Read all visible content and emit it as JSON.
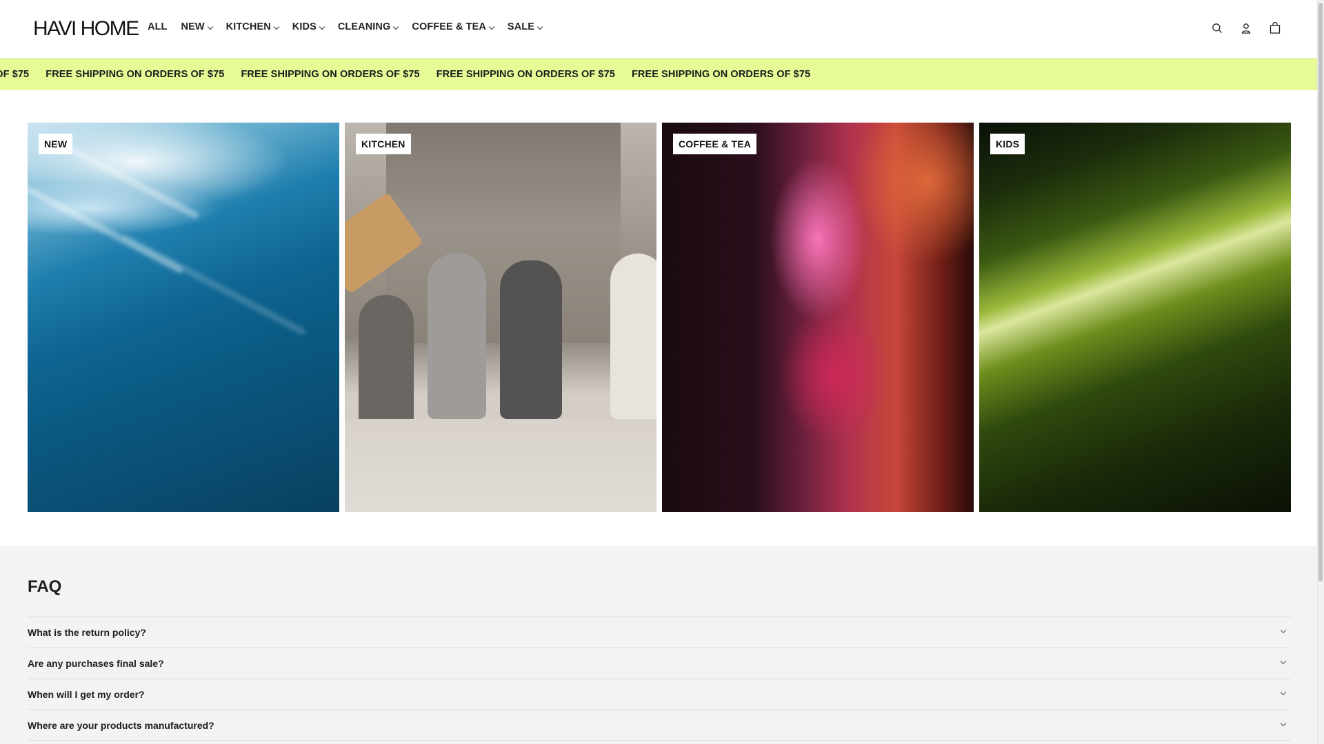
{
  "header": {
    "logo": "HAVI HOME",
    "nav": [
      {
        "label": "ALL",
        "has_dropdown": false
      },
      {
        "label": "NEW",
        "has_dropdown": true
      },
      {
        "label": "KITCHEN",
        "has_dropdown": true
      },
      {
        "label": "KIDS",
        "has_dropdown": true
      },
      {
        "label": "CLEANING",
        "has_dropdown": true
      },
      {
        "label": "COFFEE & TEA",
        "has_dropdown": true
      },
      {
        "label": "SALE",
        "has_dropdown": true
      }
    ],
    "icons": [
      "search-icon",
      "account-icon",
      "cart-icon"
    ]
  },
  "announcement": {
    "items": [
      "FREE SHIPPING ON ORDERS OF $75",
      "FREE SHIPPING ON ORDERS OF $75",
      "FREE SHIPPING ON ORDERS OF $75",
      "FREE SHIPPING ON ORDERS OF $75",
      "FREE SHIPPING ON ORDERS OF $75"
    ],
    "background": "#e6fb95"
  },
  "collage": {
    "tiles": [
      {
        "label": "NEW"
      },
      {
        "label": "KITCHEN"
      },
      {
        "label": "COFFEE & TEA"
      },
      {
        "label": "KIDS"
      }
    ]
  },
  "faq": {
    "title": "FAQ",
    "questions": [
      "What is the return policy?",
      "Are any purchases final sale?",
      "When will I get my order?",
      "Where are your products manufactured?"
    ]
  }
}
